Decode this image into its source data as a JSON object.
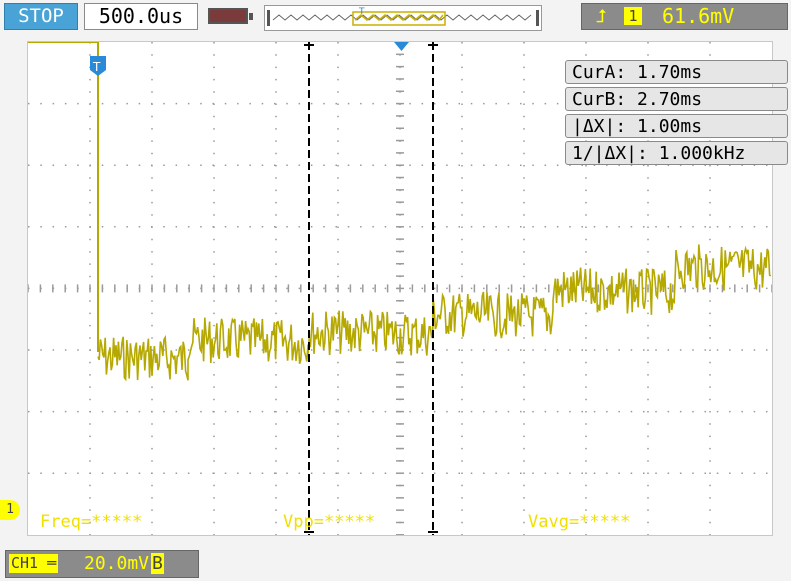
{
  "header": {
    "run_state": "STOP",
    "timebase": "500.0us",
    "trigger_edge_icon": "rising-edge-icon",
    "trigger_source": "1",
    "trigger_level": "61.6mV"
  },
  "readouts": {
    "cur_a": "CurA: 1.70ms",
    "cur_b": "CurB: 2.70ms",
    "delta_x": "|ΔX|: 1.00ms",
    "inv_delta_x": "1/|ΔX|: 1.000kHz"
  },
  "measurements": {
    "freq": "Freq=*****",
    "vpp": "Vpp=*****",
    "vavg": "Vavg=*****"
  },
  "channel": {
    "label": "CH1",
    "coupling_icon": "dc-coupling-icon",
    "scale": "20.0mV",
    "bandwidth_limit": "B"
  },
  "markers": {
    "trigger_marker": "T",
    "ground_marker": "1"
  },
  "colors": {
    "trace": "#b5a800",
    "grid": "#9a9a9a",
    "cursor": "#000000",
    "trigger_marker": "#2a8ad8",
    "stop_badge": "#4aa3d6",
    "label_yellow": "#f0e000"
  }
}
